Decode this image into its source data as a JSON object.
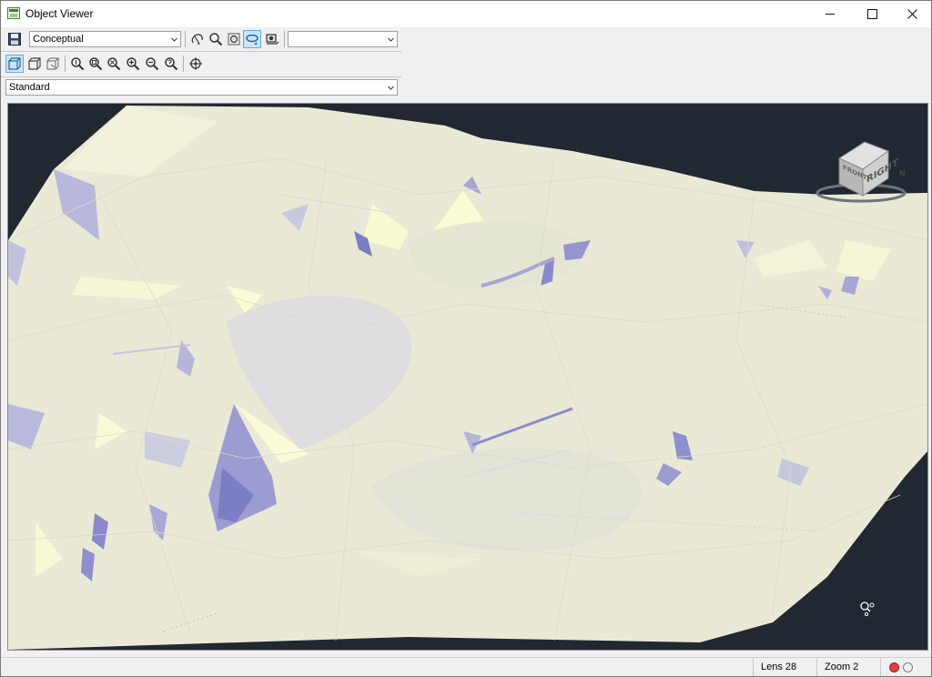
{
  "window": {
    "title": "Object Viewer",
    "icons": {
      "app": "object-viewer-icon",
      "minimize": "minimize-icon",
      "maximize": "maximize-icon",
      "close": "close-icon"
    }
  },
  "toolbar": {
    "visual_style": {
      "selected": "Conceptual"
    },
    "named_view": {
      "selected": ""
    },
    "view_mode": {
      "selected": "Standard"
    },
    "row1_icons": [
      "save-icon",
      "orbit-icon",
      "zoom-icon",
      "zoom-extents-icon",
      "orbit-active-icon",
      "camera-icon"
    ],
    "row2_icons": [
      "view-cube-front-icon",
      "view-cube-3d-icon",
      "wireframe-cube-icon",
      "zoom-realtime-icon",
      "zoom-window-icon",
      "zoom-extents-icon",
      "zoom-in-icon",
      "zoom-out-icon",
      "zoom-help-icon",
      "target-icon"
    ]
  },
  "viewcube": {
    "face_label": "RIGHT",
    "side_label": "FRONT",
    "compass_label": "N"
  },
  "status": {
    "lens": "Lens 28",
    "zoom": "Zoom 2"
  },
  "colors": {
    "viewport_background": "#222831",
    "terrain_base": "#e9e9d6",
    "terrain_highlight": "#fbfbd8",
    "terrain_shadow": "#a3a3d4",
    "terrain_shadow_dark": "#7d7dc6"
  }
}
